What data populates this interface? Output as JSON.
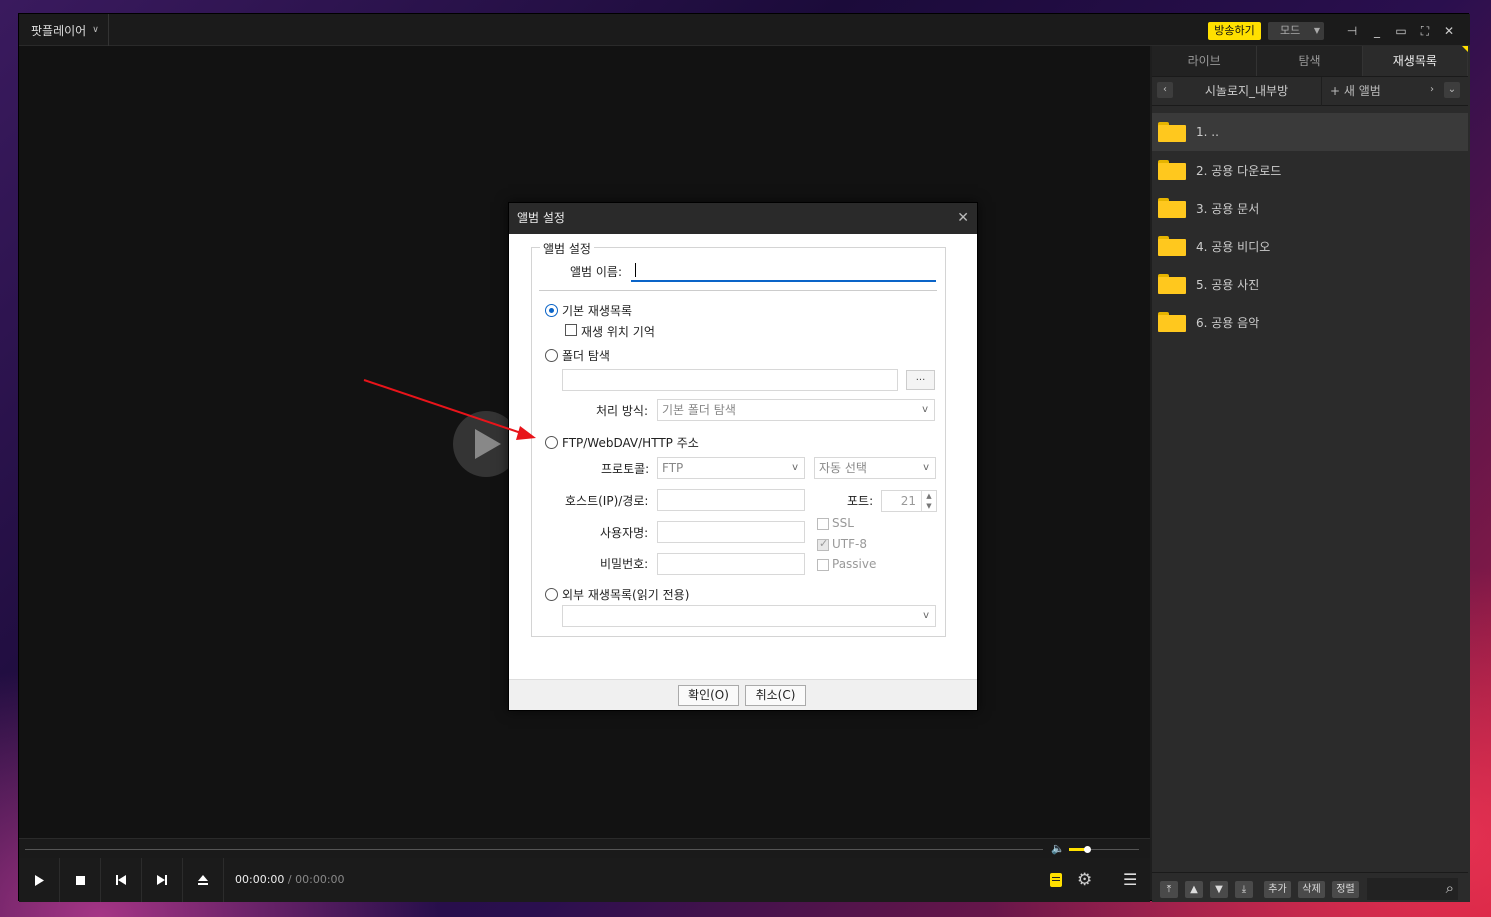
{
  "app": {
    "menu_label": "팟플레이어",
    "broadcast_label": "방송하기",
    "mode_label": "모드"
  },
  "player": {
    "time_current": "00:00:00",
    "time_separator": "/",
    "time_total": "00:00:00",
    "volume_level": 0.25
  },
  "panel": {
    "tabs": [
      {
        "label": "라이브"
      },
      {
        "label": "탐색"
      },
      {
        "label": "재생목록"
      }
    ],
    "album_name": "시놀로지_내부방",
    "new_album_label": "+ 새 앨범",
    "items": [
      {
        "label": "1. .."
      },
      {
        "label": "2. 공용 다운로드"
      },
      {
        "label": "3. 공용 문서"
      },
      {
        "label": "4. 공용 비디오"
      },
      {
        "label": "5. 공용 사진"
      },
      {
        "label": "6. 공용 음악"
      }
    ],
    "footer": {
      "add": "추가",
      "delete": "삭제",
      "sort": "정렬"
    }
  },
  "dialog": {
    "title": "앨범 설정",
    "group_label": "앨범 설정",
    "album_name_label": "앨범 이름:",
    "album_name_value": "",
    "opt_default_playlist": "기본 재생목록",
    "chk_remember_position": "재생 위치 기억",
    "opt_folder_browse": "폴더 탐색",
    "processing_label": "처리 방식:",
    "processing_value": "기본 폴더 탐색",
    "opt_ftp": "FTP/WebDAV/HTTP 주소",
    "protocol_label": "프로토콜:",
    "protocol_value": "FTP",
    "encoding_value": "자동 선택",
    "host_label": "호스트(IP)/경로:",
    "port_label": "포트:",
    "port_value": "21",
    "username_label": "사용자명:",
    "password_label": "비밀번호:",
    "ssl_label": "SSL",
    "utf8_label": "UTF-8",
    "passive_label": "Passive",
    "opt_external": "외부 재생목록(읽기 전용)",
    "ok_label": "확인(O)",
    "cancel_label": "취소(C)",
    "browse_label": "..."
  },
  "colors": {
    "accent": "#ffe000",
    "selection": "#0a64c8",
    "annotation_arrow": "#e8141a"
  }
}
